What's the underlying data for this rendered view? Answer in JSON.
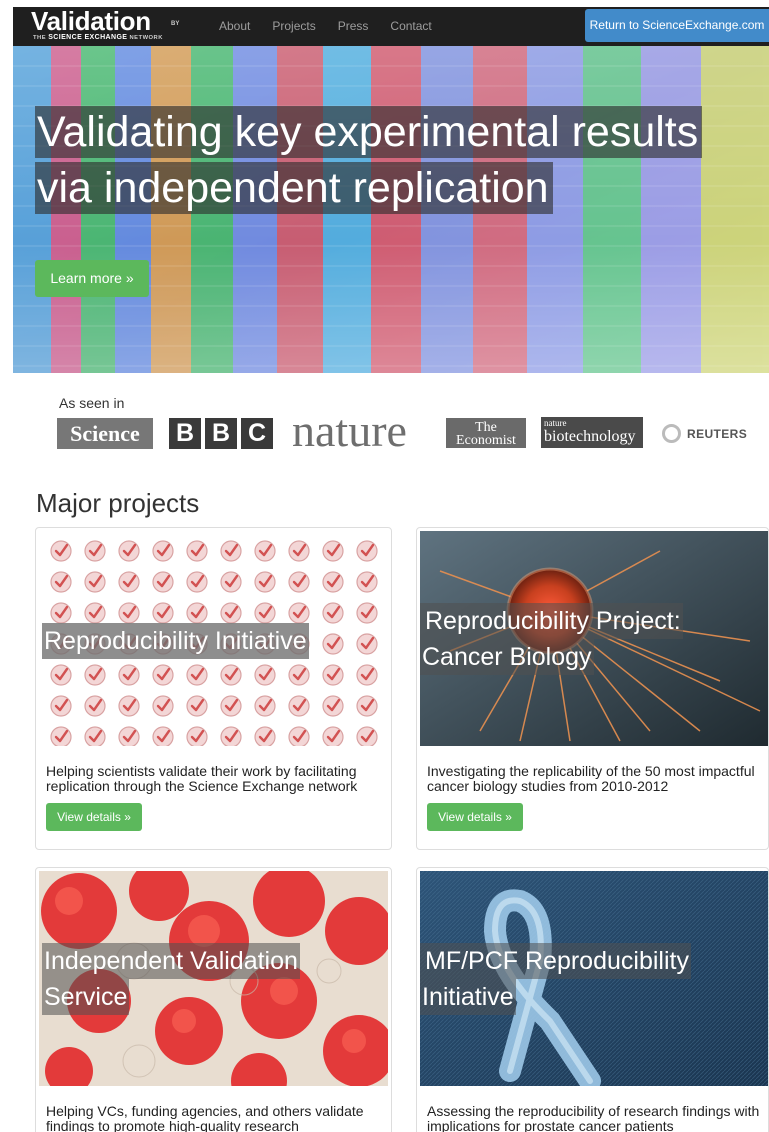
{
  "navbar": {
    "brand_main": "Validation",
    "brand_by": "BY",
    "brand_sub_prefix": "THE ",
    "brand_sub_bold": "SCIENCE EXCHANGE",
    "brand_sub_suffix": " NETWORK",
    "links": [
      "About",
      "Projects",
      "Press",
      "Contact"
    ],
    "return_label": "Return to ScienceExchange.com"
  },
  "hero": {
    "title_line1": "Validating key experimental results",
    "title_line2": "via independent replication",
    "cta_label": "Learn more »"
  },
  "press": {
    "label": "As seen in",
    "science": "Science",
    "bbc": [
      "B",
      "B",
      "C"
    ],
    "nature": "nature",
    "economist_top": "The",
    "economist_bottom": "Economist",
    "biotech_small": "nature",
    "biotech_big": "biotechnology",
    "reuters": "REUTERS"
  },
  "projects": {
    "section_title": "Major projects",
    "cards": [
      {
        "title_lines": [
          "Reproducibility Initiative"
        ],
        "description": "Helping scientists validate their work by facilitating replication through the Science Exchange network",
        "button_label": "View details »"
      },
      {
        "title_lines": [
          "Reproducibility Project:",
          "Cancer Biology"
        ],
        "description": "Investigating the replicability of the 50 most impactful cancer biology studies from 2010-2012",
        "button_label": "View details »"
      },
      {
        "title_lines": [
          "Independent Validation",
          "Service"
        ],
        "description": "Helping VCs, funding agencies, and others validate findings to promote high-quality research"
      },
      {
        "title_lines": [
          "MF/PCF Reproducibility",
          "Initiative"
        ],
        "description": "Assessing the reproducibility of research findings with implications for prostate cancer patients"
      }
    ]
  },
  "colors": {
    "navbar_bg": "#1f1f1f",
    "primary_blue": "#428bca",
    "success_green": "#5cb85c"
  },
  "icons": {
    "checkmark_badge": "validation-check-icon",
    "reuters_logo": "reuters-dot-icon"
  }
}
